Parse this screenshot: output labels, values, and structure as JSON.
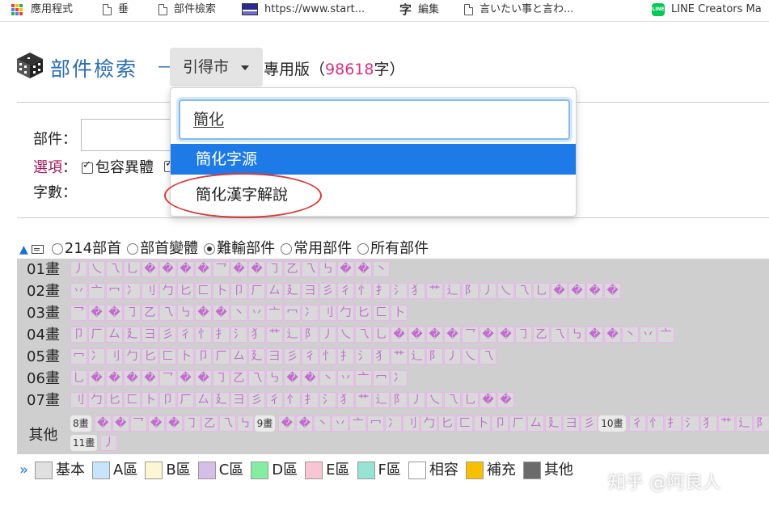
{
  "bookmarks": [
    {
      "label": "應用程式",
      "icon": "apps-grid-icon"
    },
    {
      "label": "垂",
      "icon": "document-icon"
    },
    {
      "label": "部件檢索",
      "icon": "document-icon"
    },
    {
      "label": "https://www.start...",
      "icon": "site-thumbnail-icon"
    },
    {
      "label": "編集",
      "icon": "zi-character-icon"
    },
    {
      "label": "言いたい事と言わ...",
      "icon": "document-icon"
    },
    {
      "label": "LINE Creators Ma",
      "icon": "line-logo-icon"
    }
  ],
  "header": {
    "title": "部件檢索",
    "dash": "－",
    "dictionary_button": "引得市",
    "edition_prefix": "專用版（",
    "char_count": "98618",
    "edition_suffix": "字）"
  },
  "form": {
    "component_label": "部件",
    "options_label": "選項",
    "colon": "：",
    "include_variants": "包容異體",
    "stroke_label": "字數",
    "component_value": ""
  },
  "dropdown": {
    "search_value": "簡化",
    "items": [
      "簡化字源",
      "簡化漢字解說"
    ],
    "active_index": 0
  },
  "radio_options": [
    {
      "label": "214部首",
      "selected": false
    },
    {
      "label": "部首變體",
      "selected": false
    },
    {
      "label": "難輸部件",
      "selected": true
    },
    {
      "label": "常用部件",
      "selected": false
    },
    {
      "label": "所有部件",
      "selected": false
    }
  ],
  "stroke_rows": [
    {
      "label": "01畫",
      "count": 18
    },
    {
      "label": "02畫",
      "count": 31
    },
    {
      "label": "03畫",
      "count": 19
    },
    {
      "label": "04畫",
      "count": 34
    },
    {
      "label": "05畫",
      "count": 24
    },
    {
      "label": "06畫",
      "count": 19
    },
    {
      "label": "07畫",
      "count": 25
    }
  ],
  "other_row": {
    "label": "其他",
    "groups": [
      {
        "tag": "8畫",
        "count": 9
      },
      {
        "tag": "9畫",
        "count": 18
      },
      {
        "tag": "10畫",
        "count": 8
      },
      {
        "tag": "11畫",
        "count": 0
      }
    ],
    "trailing_count": 1
  },
  "legend": [
    {
      "label": "基本",
      "color": "#e0e0e0"
    },
    {
      "label": "A區",
      "color": "#c7e4fb"
    },
    {
      "label": "B區",
      "color": "#fdf6d2"
    },
    {
      "label": "C區",
      "color": "#d5bfe6"
    },
    {
      "label": "D區",
      "color": "#84eda2"
    },
    {
      "label": "E區",
      "color": "#f8c6d2"
    },
    {
      "label": "F區",
      "color": "#97e4d4"
    },
    {
      "label": "相容",
      "color": "#ffffff"
    },
    {
      "label": "補充",
      "color": "#f6c000"
    },
    {
      "label": "其他",
      "color": "#6b6b6b"
    }
  ],
  "watermark": "知乎 @阿良人",
  "colors": {
    "title_blue": "#2f6fb0",
    "count_pink": "#d63384",
    "dropdown_active": "#1e7ae6",
    "annotation_red": "#d63a3a",
    "cell_glyph": "#c36bd0"
  }
}
